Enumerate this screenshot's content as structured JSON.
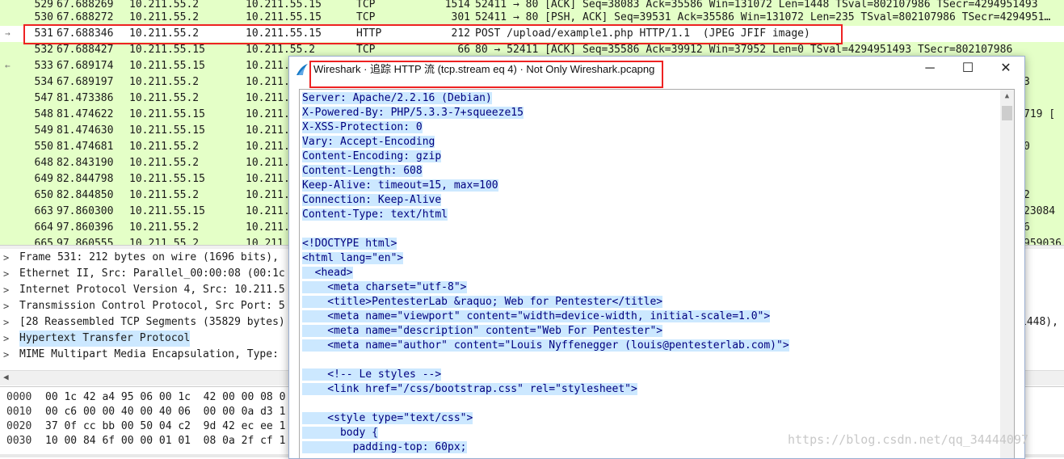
{
  "packets": [
    {
      "no": "529",
      "time": "67.688269",
      "src": "10.211.55.2",
      "dst": "10.211.55.15",
      "proto": "TCP",
      "len": "1514",
      "info": "52411 → 80 [ACK] Seq=38083 Ack=35586 Win=131072 Len=1448 TSval=802107986 TSecr=4294951493"
    },
    {
      "no": "530",
      "time": "67.688272",
      "src": "10.211.55.2",
      "dst": "10.211.55.15",
      "proto": "TCP",
      "len": "301",
      "info": "52411 → 80 [PSH, ACK] Seq=39531 Ack=35586 Win=131072 Len=235 TSval=802107986 TSecr=4294951…"
    },
    {
      "no": "531",
      "time": "67.688346",
      "src": "10.211.55.2",
      "dst": "10.211.55.15",
      "proto": "HTTP",
      "len": "212",
      "info": "POST /upload/example1.php HTTP/1.1  (JPEG JFIF image)"
    },
    {
      "no": "532",
      "time": "67.688427",
      "src": "10.211.55.15",
      "dst": "10.211.55.2",
      "proto": "TCP",
      "len": "66",
      "info": "80 → 52411 [ACK] Seq=35586 Ack=39912 Win=37952 Len=0 TSval=4294951493 TSecr=802107986"
    },
    {
      "no": "533",
      "time": "67.689174",
      "src": "10.211.55.15",
      "dst": "10.211.",
      "proto": "",
      "len": "",
      "info": ""
    },
    {
      "no": "534",
      "time": "67.689197",
      "src": "10.211.55.2",
      "dst": "10.211.",
      "proto": "",
      "len": "",
      "info": ""
    },
    {
      "no": "547",
      "time": "81.473386",
      "src": "10.211.55.2",
      "dst": "10.211.",
      "proto": "",
      "len": "",
      "info": ""
    },
    {
      "no": "548",
      "time": "81.474622",
      "src": "10.211.55.15",
      "dst": "10.211.",
      "proto": "",
      "len": "",
      "info": ""
    },
    {
      "no": "549",
      "time": "81.474630",
      "src": "10.211.55.15",
      "dst": "10.211.",
      "proto": "",
      "len": "",
      "info": ""
    },
    {
      "no": "550",
      "time": "81.474681",
      "src": "10.211.55.2",
      "dst": "10.211.",
      "proto": "",
      "len": "",
      "info": ""
    },
    {
      "no": "648",
      "time": "82.843190",
      "src": "10.211.55.2",
      "dst": "10.211.",
      "proto": "",
      "len": "",
      "info": ""
    },
    {
      "no": "649",
      "time": "82.844798",
      "src": "10.211.55.15",
      "dst": "10.211.",
      "proto": "",
      "len": "",
      "info": ""
    },
    {
      "no": "650",
      "time": "82.844850",
      "src": "10.211.55.2",
      "dst": "10.211.",
      "proto": "",
      "len": "",
      "info": ""
    },
    {
      "no": "663",
      "time": "97.860300",
      "src": "10.211.55.15",
      "dst": "10.211.",
      "proto": "",
      "len": "",
      "info": ""
    },
    {
      "no": "664",
      "time": "97.860396",
      "src": "10.211.55.2",
      "dst": "10.211.",
      "proto": "",
      "len": "",
      "info": ""
    },
    {
      "no": "665",
      "time": "97.860555",
      "src": "10.211.55.2",
      "dst": "10.211.",
      "proto": "",
      "len": "",
      "info": ""
    }
  ],
  "packet_right_fragments": [
    "3",
    "719 [",
    "0",
    "2",
    "23084",
    "6",
    "959036"
  ],
  "details": [
    {
      "label": "Frame 531: 212 bytes on wire (1696 bits),",
      "right": ""
    },
    {
      "label": "Ethernet II, Src: Parallel_00:00:08 (00:1c",
      "right": ""
    },
    {
      "label": "Internet Protocol Version 4, Src: 10.211.5",
      "right": ""
    },
    {
      "label": "Transmission Control Protocol, Src Port: 5",
      "right": ""
    },
    {
      "label": "[28 Reassembled TCP Segments (35829 bytes)",
      "right": "1448),"
    },
    {
      "label": "Hypertext Transfer Protocol",
      "right": ""
    },
    {
      "label": "MIME Multipart Media Encapsulation, Type:",
      "right": ""
    }
  ],
  "bytes": [
    {
      "offset": "0000",
      "hex": "00 1c 42 a4 95 06 00 1c  42 00 00 08 0"
    },
    {
      "offset": "0010",
      "hex": "00 c6 00 00 40 00 40 06  00 00 0a d3 1"
    },
    {
      "offset": "0020",
      "hex": "37 0f cc bb 00 50 04 c2  9d 42 ec ee 1"
    },
    {
      "offset": "0030",
      "hex": "10 00 84 6f 00 00 01 01  08 0a 2f cf 1"
    }
  ],
  "dialog": {
    "title": "Wireshark · 追踪 HTTP 流 (tcp.stream eq 4) · Not Only Wireshark.pcapng",
    "minimize": "─",
    "maximize": "☐",
    "close": "✕",
    "server_lines": [
      "Server: Apache/2.2.16 (Debian)",
      "X-Powered-By: PHP/5.3.3-7+squeeze15",
      "X-XSS-Protection: 0",
      "Vary: Accept-Encoding",
      "Content-Encoding: gzip",
      "Content-Length: 608",
      "Keep-Alive: timeout=15, max=100",
      "Connection: Keep-Alive",
      "Content-Type: text/html"
    ],
    "body_lines": [
      "",
      "<!DOCTYPE html>",
      "<html lang=\"en\">",
      "  <head>",
      "    <meta charset=\"utf-8\">",
      "    <title>PentesterLab &raquo; Web for Pentester</title>",
      "    <meta name=\"viewport\" content=\"width=device-width, initial-scale=1.0\">",
      "    <meta name=\"description\" content=\"Web For Pentester\">",
      "    <meta name=\"author\" content=\"Louis Nyffenegger (louis@pentesterlab.com)\">",
      "",
      "    <!-- Le styles -->",
      "    <link href=\"/css/bootstrap.css\" rel=\"stylesheet\">",
      "",
      "    <style type=\"text/css\">",
      "      body {",
      "        padding-top: 60px;"
    ]
  },
  "watermark": "https://blog.csdn.net/qq_34444097",
  "colors": {
    "tcp_row": "#e4ffc7",
    "selected_row": "#ffffff",
    "highlight": "#cce8ff",
    "red_box": "#ee2222",
    "stream_text": "#00007f"
  }
}
